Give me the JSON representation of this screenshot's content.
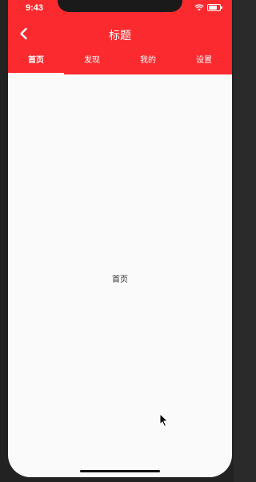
{
  "status_bar": {
    "time": "9:43"
  },
  "header": {
    "title": "标题",
    "back_icon": "chevron-left-icon",
    "background_color": "#fb2a2f"
  },
  "tabs": [
    {
      "label": "首页",
      "active": true
    },
    {
      "label": "发现",
      "active": false
    },
    {
      "label": "我的",
      "active": false
    },
    {
      "label": "设置",
      "active": false
    }
  ],
  "main": {
    "content": "首页"
  }
}
